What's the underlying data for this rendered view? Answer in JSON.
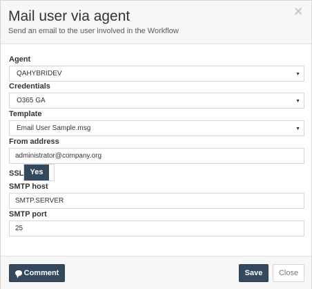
{
  "dialog": {
    "title": "Mail user via agent",
    "subtitle": "Send an email to the user involved in the Workflow",
    "close_icon": "×"
  },
  "form": {
    "agent": {
      "label": "Agent",
      "value": "QAHYBRIDEV"
    },
    "credentials": {
      "label": "Credentials",
      "value": "O365 GA"
    },
    "template": {
      "label": "Template",
      "value": "Email User Sample.msg"
    },
    "from_address": {
      "label": "From address",
      "value": "administrator@company.org"
    },
    "ssl": {
      "label": "SSL",
      "state_label": "Yes",
      "enabled": true
    },
    "smtp_host": {
      "label": "SMTP host",
      "value": "SMTP.SERVER"
    },
    "smtp_port": {
      "label": "SMTP port",
      "value": "25"
    }
  },
  "footer": {
    "comment_label": "Comment",
    "save_label": "Save",
    "close_label": "Close"
  },
  "icons": {
    "caret": "chevron-down-icon",
    "comment": "comment-icon"
  },
  "colors": {
    "primary": "#34495e",
    "header_bg": "#f7f7f7",
    "border": "#d6d6d6"
  }
}
